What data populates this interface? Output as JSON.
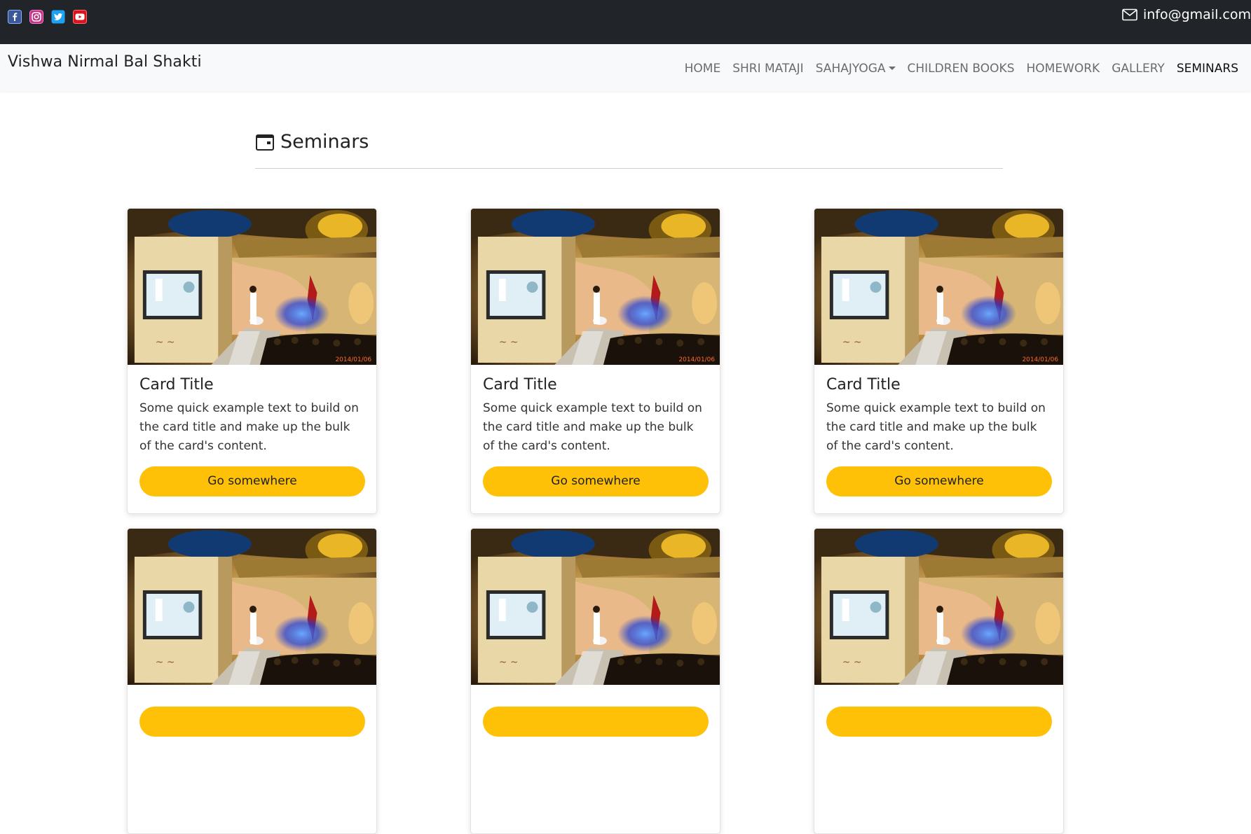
{
  "topbar": {
    "social": [
      "facebook-icon",
      "instagram-icon",
      "twitter-icon",
      "youtube-icon"
    ],
    "email": "info@gmail.com"
  },
  "navbar": {
    "brand": "Vishwa Nirmal Bal Shakti",
    "links": [
      "HOME",
      "SHRI MATAJI",
      "SAHAJYOGA",
      "CHILDREN BOOKS",
      "HOMEWORK",
      "GALLERY",
      "SEMINARS"
    ],
    "active": "SEMINARS"
  },
  "section": {
    "title": "Seminars",
    "icon": "calendar-icon"
  },
  "cards": [
    {
      "image_stamp": "2014/01/06",
      "title": "Card Title",
      "text": "Some quick example text to build on the card title and make up the bulk of the card's content.",
      "button": "Go somewhere"
    },
    {
      "image_stamp": "2014/01/06",
      "title": "Card Title",
      "text": "Some quick example text to build on the card title and make up the bulk of the card's content.",
      "button": "Go somewhere"
    },
    {
      "image_stamp": "2014/01/06",
      "title": "Card Title",
      "text": "Some quick example text to build on the card title and make up the bulk of the card's content.",
      "button": "Go somewhere"
    },
    {
      "image_stamp": "",
      "title": "",
      "text": "",
      "button": ""
    },
    {
      "image_stamp": "",
      "title": "",
      "text": "",
      "button": ""
    },
    {
      "image_stamp": "",
      "title": "",
      "text": "",
      "button": ""
    }
  ],
  "colors": {
    "topbar": "#212529",
    "navbar": "#f8f9fa",
    "button": "#ffc107"
  }
}
